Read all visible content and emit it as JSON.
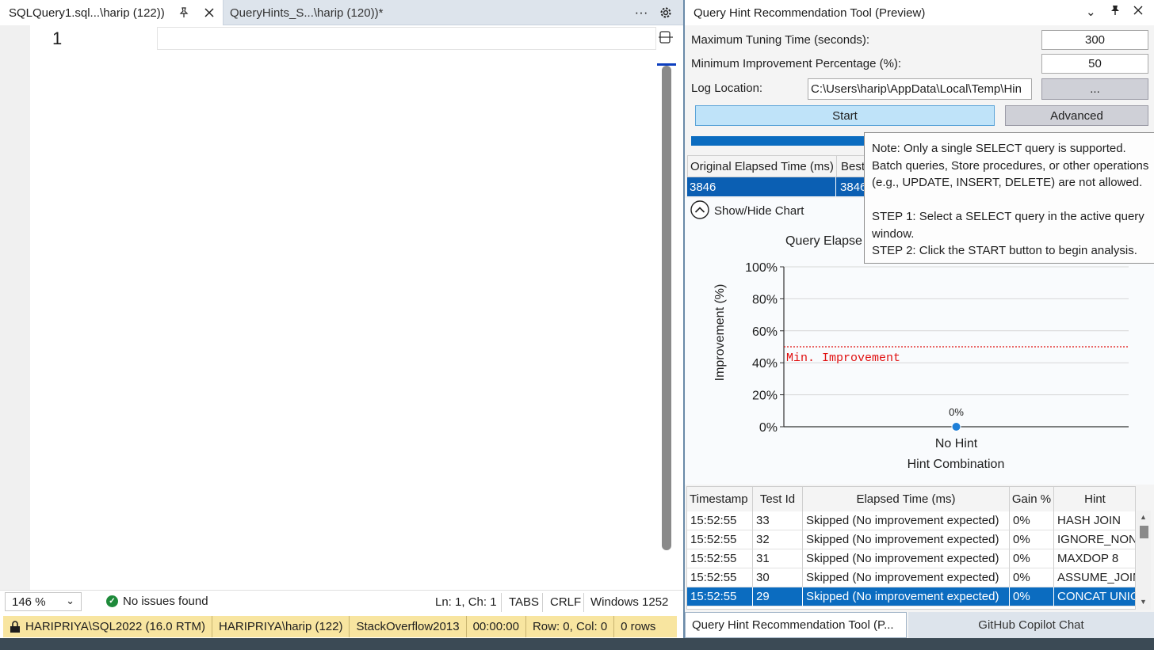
{
  "editor": {
    "tabs": [
      {
        "label": "SQLQuery1.sql...\\harip (122))"
      },
      {
        "label": "QueryHints_S...\\harip (120))*"
      }
    ],
    "line_number": "1",
    "zoom": "146 %",
    "issues": "No issues found",
    "position": "Ln: 1, Ch: 1",
    "indent": "TABS",
    "line_ending": "CRLF",
    "encoding": "Windows 1252"
  },
  "connection_bar": {
    "server": "HARIPRIYA\\SQL2022 (16.0 RTM)",
    "user": "HARIPRIYA\\harip (122)",
    "database": "StackOverflow2013",
    "elapsed": "00:00:00",
    "rowcol": "Row: 0, Col: 0",
    "rows": "0 rows"
  },
  "panel": {
    "title": "Query Hint Recommendation Tool (Preview)",
    "max_tuning_label": "Maximum Tuning Time (seconds):",
    "max_tuning_value": "300",
    "min_improvement_label": "Minimum Improvement Percentage (%):",
    "min_improvement_value": "50",
    "log_label": "Log Location:",
    "log_value": "C:\\Users\\harip\\AppData\\Local\\Temp\\Hin",
    "browse_label": "...",
    "start_label": "Start",
    "advanced_label": "Advanced",
    "progress": 1.0,
    "summary": {
      "col1": "Original Elapsed Time (ms)",
      "col2": "Best",
      "val1": "3846",
      "val2": "3846"
    },
    "show_hide_chart": "Show/Hide Chart",
    "tooltip": {
      "line1": "Note: Only a single SELECT query is supported.",
      "line2": "Batch queries, Store procedures, or other operations",
      "line3": "(e.g., UPDATE, INSERT, DELETE) are not allowed.",
      "line4": "STEP 1: Select a SELECT query in the active query",
      "line5": "window.",
      "line6": "STEP 2: Click the START button to begin analysis."
    },
    "bottom_tabs": {
      "tab1": "Query Hint Recommendation Tool (P...",
      "tab2": "GitHub Copilot Chat"
    }
  },
  "chart_data": {
    "type": "scatter",
    "title": "Query Elapse",
    "xlabel": "Hint Combination",
    "ylabel": "Improvement (%)",
    "ylim": [
      0,
      100
    ],
    "yticks": [
      "100%",
      "80%",
      "60%",
      "40%",
      "20%",
      "0%"
    ],
    "categories": [
      "No Hint"
    ],
    "values": [
      0
    ],
    "point_labels": [
      "0%"
    ],
    "threshold": {
      "value": 50,
      "label": "Min. Improvement",
      "color": "#e01010"
    },
    "point_color": "#1e7fd8",
    "grid": true
  },
  "results": {
    "headers": [
      "Timestamp",
      "Test Id",
      "Elapsed Time (ms)",
      "Gain %",
      "Hint"
    ],
    "rows": [
      [
        "15:52:55",
        "33",
        "Skipped (No improvement expected)",
        "0%",
        "HASH JOIN"
      ],
      [
        "15:52:55",
        "32",
        "Skipped (No improvement expected)",
        "0%",
        "IGNORE_NON"
      ],
      [
        "15:52:55",
        "31",
        "Skipped (No improvement expected)",
        "0%",
        "MAXDOP 8"
      ],
      [
        "15:52:55",
        "30",
        "Skipped (No improvement expected)",
        "0%",
        "ASSUME_JOIN"
      ],
      [
        "15:52:55",
        "29",
        "Skipped (No improvement expected)",
        "0%",
        "CONCAT UNIO"
      ]
    ],
    "selected_index": 4
  },
  "colors": {
    "accent": "#0b6cc0",
    "connection_bar": "#f8e5a0",
    "start_button": "#bfe3f9"
  }
}
